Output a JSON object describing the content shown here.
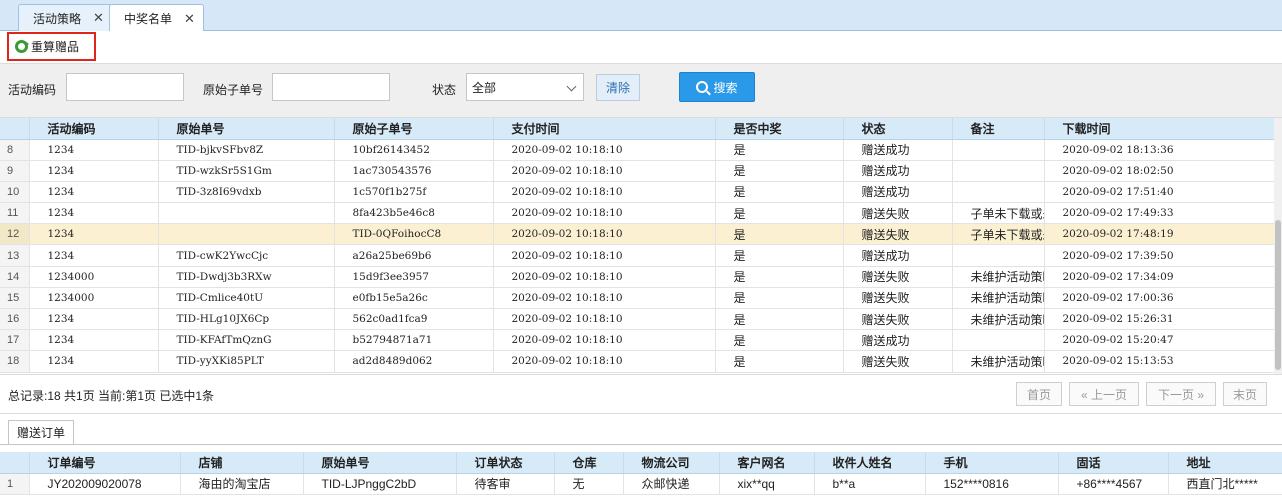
{
  "tabs": [
    {
      "label": "活动策略",
      "active": false
    },
    {
      "label": "中奖名单",
      "active": true
    }
  ],
  "toolbar": {
    "recalc_label": "重算赠品"
  },
  "filters": {
    "activity_code_label": "活动编码",
    "activity_code_value": "",
    "sub_order_label": "原始子单号",
    "sub_order_value": "",
    "status_label": "状态",
    "status_value": "全部",
    "clear_label": "清除",
    "search_label": "搜索"
  },
  "grid": {
    "columns": [
      "活动编码",
      "原始单号",
      "原始子单号",
      "支付时间",
      "是否中奖",
      "状态",
      "备注",
      "下载时间"
    ],
    "rows": [
      {
        "n": "8",
        "cells": [
          "1234",
          "TID-bjkvSFbv8Z",
          "10bf26143452",
          "2020-09-02 10:18:10",
          "是",
          "赠送成功",
          "",
          "2020-09-02 18:13:36"
        ]
      },
      {
        "n": "9",
        "cells": [
          "1234",
          "TID-wzkSr5S1Gm",
          "1ac730543576",
          "2020-09-02 10:18:10",
          "是",
          "赠送成功",
          "",
          "2020-09-02 18:02:50"
        ]
      },
      {
        "n": "10",
        "cells": [
          "1234",
          "TID-3z8I69vdxb",
          "1c570f1b275f",
          "2020-09-02 10:18:10",
          "是",
          "赠送成功",
          "",
          "2020-09-02 17:51:40"
        ]
      },
      {
        "n": "11",
        "cells": [
          "1234",
          "",
          "8fa423b5e46c8",
          "2020-09-02 10:18:10",
          "是",
          "赠送失败",
          "子单未下载或未",
          "2020-09-02 17:49:33"
        ]
      },
      {
        "n": "12",
        "cells": [
          "1234",
          "",
          "TID-0QFoihocC8",
          "2020-09-02 10:18:10",
          "是",
          "赠送失败",
          "子单未下载或未",
          "2020-09-02 17:48:19"
        ]
      },
      {
        "n": "13",
        "cells": [
          "1234",
          "TID-cwK2YwcCjc",
          "a26a25be69b6",
          "2020-09-02 10:18:10",
          "是",
          "赠送成功",
          "",
          "2020-09-02 17:39:50"
        ]
      },
      {
        "n": "14",
        "cells": [
          "1234000",
          "TID-Dwdj3b3RXw",
          "15d9f3ee3957",
          "2020-09-02 10:18:10",
          "是",
          "赠送失败",
          "未维护活动策略",
          "2020-09-02 17:34:09"
        ]
      },
      {
        "n": "15",
        "cells": [
          "1234000",
          "TID-Cmlice40tU",
          "e0fb15e5a26c",
          "2020-09-02 10:18:10",
          "是",
          "赠送失败",
          "未维护活动策略",
          "2020-09-02 17:00:36"
        ]
      },
      {
        "n": "16",
        "cells": [
          "1234",
          "TID-HLg10JX6Cp",
          "562c0ad1fca9",
          "2020-09-02 10:18:10",
          "是",
          "赠送失败",
          "未维护活动策略",
          "2020-09-02 15:26:31"
        ]
      },
      {
        "n": "17",
        "cells": [
          "1234",
          "TID-KFAfTmQznG",
          "b52794871a71",
          "2020-09-02 10:18:10",
          "是",
          "赠送成功",
          "",
          "2020-09-02 15:20:47"
        ]
      },
      {
        "n": "18",
        "cells": [
          "1234",
          "TID-yyXKi85PLT",
          "ad2d8489d062",
          "2020-09-02 10:18:10",
          "是",
          "赠送失败",
          "未维护活动策略",
          "2020-09-02 15:13:53"
        ]
      }
    ],
    "selected_row": "12"
  },
  "pager": {
    "summary": "总记录:18 共1页 当前:第1页 已选中1条",
    "first": "首页",
    "prev": "« 上一页",
    "next": "下一页 »",
    "last": "末页"
  },
  "subtab": {
    "label": "赠送订单"
  },
  "grid2": {
    "columns": [
      "订单编号",
      "店铺",
      "原始单号",
      "订单状态",
      "仓库",
      "物流公司",
      "客户网名",
      "收件人姓名",
      "手机",
      "固话",
      "地址"
    ],
    "rows": [
      {
        "n": "1",
        "cells": [
          "JY202009020078",
          "海由的淘宝店",
          "TID-LJPnggC2bD",
          "待客审",
          "无",
          "众邮快递",
          "xix**qq",
          "b**a",
          "152****0816",
          "+86****4567",
          "西直门北*****"
        ]
      }
    ]
  },
  "colors": {
    "accent": "#2a9ae8",
    "tab_bg": "#d6e8f8",
    "header_bg": "#d7eaf8",
    "selected_row": "#fbf1d2",
    "highlight_border": "#e0261c"
  },
  "icons": {
    "recalc": "refresh-icon",
    "search": "search-icon",
    "close": "close-icon"
  }
}
